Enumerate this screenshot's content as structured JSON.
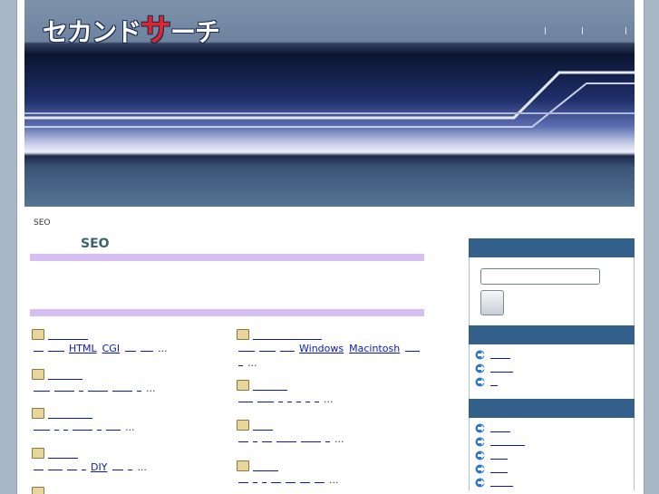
{
  "header": {
    "logo_part1": "セカンド",
    "logo_accent": "サ",
    "logo_part2": "ーチ"
  },
  "breadcrumb": "SEO",
  "page_title": "SEO",
  "categories": {
    "left": [
      {
        "links": [
          "HTML",
          "CGI"
        ],
        "ellipsis": "..."
      },
      {
        "links": [],
        "ellipsis": "..."
      },
      {
        "links": [],
        "ellipsis": "..."
      },
      {
        "links": [
          "DIY"
        ],
        "ellipsis": "..."
      }
    ],
    "right": [
      {
        "links": [
          "Windows",
          "Macintosh"
        ],
        "ellipsis": "..."
      },
      {
        "links": [],
        "ellipsis": "..."
      },
      {
        "links": [],
        "ellipsis": "..."
      },
      {
        "links": [],
        "ellipsis": "..."
      }
    ]
  },
  "colors": {
    "sidebar_header": "#34608c",
    "accent_bar": "#d6bef3",
    "link": "#0a1ab0"
  },
  "icons": [
    "folder-icon",
    "arrow-right-icon"
  ]
}
